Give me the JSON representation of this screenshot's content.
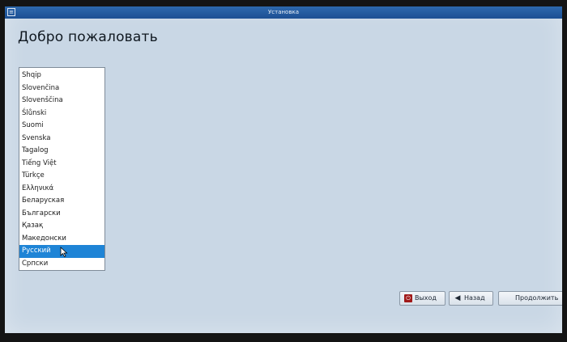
{
  "window": {
    "title": "Установка",
    "icon": "installer-icon"
  },
  "heading": "Добро пожаловать",
  "languages": {
    "items": [
      "Shqip",
      "Slovenčina",
      "Slovenščina",
      "Ślůnski",
      "Suomi",
      "Svenska",
      "Tagalog",
      "Tiếng Việt",
      "Türkçe",
      "Ελληνικά",
      "Беларуская",
      "Български",
      "Қазақ",
      "Македонски",
      "Русский",
      "Српски"
    ],
    "selected": "Русский",
    "selected_color": "#1e84d6"
  },
  "buttons": {
    "exit": "Выход",
    "back": "Назад",
    "next": "Продолжить"
  },
  "colors": {
    "background": "#c9d7e5",
    "titlebar": "#1c4f93"
  }
}
